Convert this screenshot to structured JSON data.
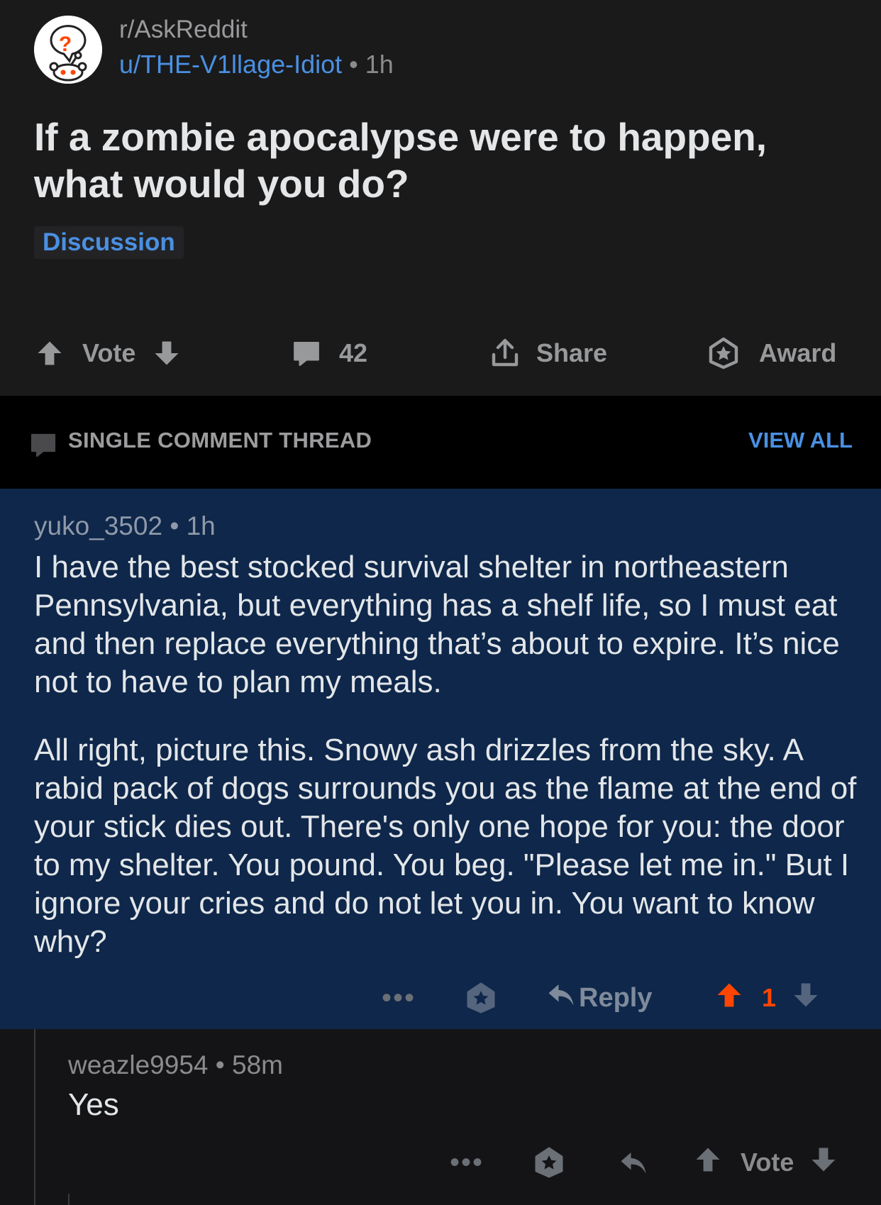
{
  "post": {
    "subreddit": "r/AskReddit",
    "author": "u/THE-V1llage-Idiot",
    "separator": " • ",
    "age": "1h",
    "title": "If a zombie apocalypse were to happen, what would you do?",
    "flair": "Discussion",
    "vote_label": "Vote",
    "comment_count": "42",
    "share_label": "Share",
    "award_label": "Award"
  },
  "thread_bar": {
    "label": "SINGLE COMMENT THREAD",
    "view_all": "VIEW ALL"
  },
  "comment": {
    "author": "yuko_3502",
    "separator": " • ",
    "age": "1h",
    "paragraphs": [
      "I have the best stocked survival shelter in northeastern Pennsylvania, but everything has a shelf life, so I must eat and then replace everything that’s about to expire. It’s nice not to have to plan my meals.",
      "All right, picture this. Snowy ash drizzles from the sky. A rabid pack of dogs surrounds you as the flame at the end of your stick dies out. There's only one hope for you: the door to my shelter. You pound. You beg. \"Please let me in.\" But I ignore your cries and do not let you in. You want to know why?"
    ],
    "more": "•••",
    "reply_label": "Reply",
    "score": "1"
  },
  "reply": {
    "author": "weazle9954",
    "separator": " • ",
    "age": "58m",
    "body": "Yes",
    "more": "•••",
    "vote_label": "Vote"
  },
  "colors": {
    "upvote_active": "#ff4500",
    "link_blue": "#4a90e2",
    "comment_highlight": "#0e274a"
  }
}
